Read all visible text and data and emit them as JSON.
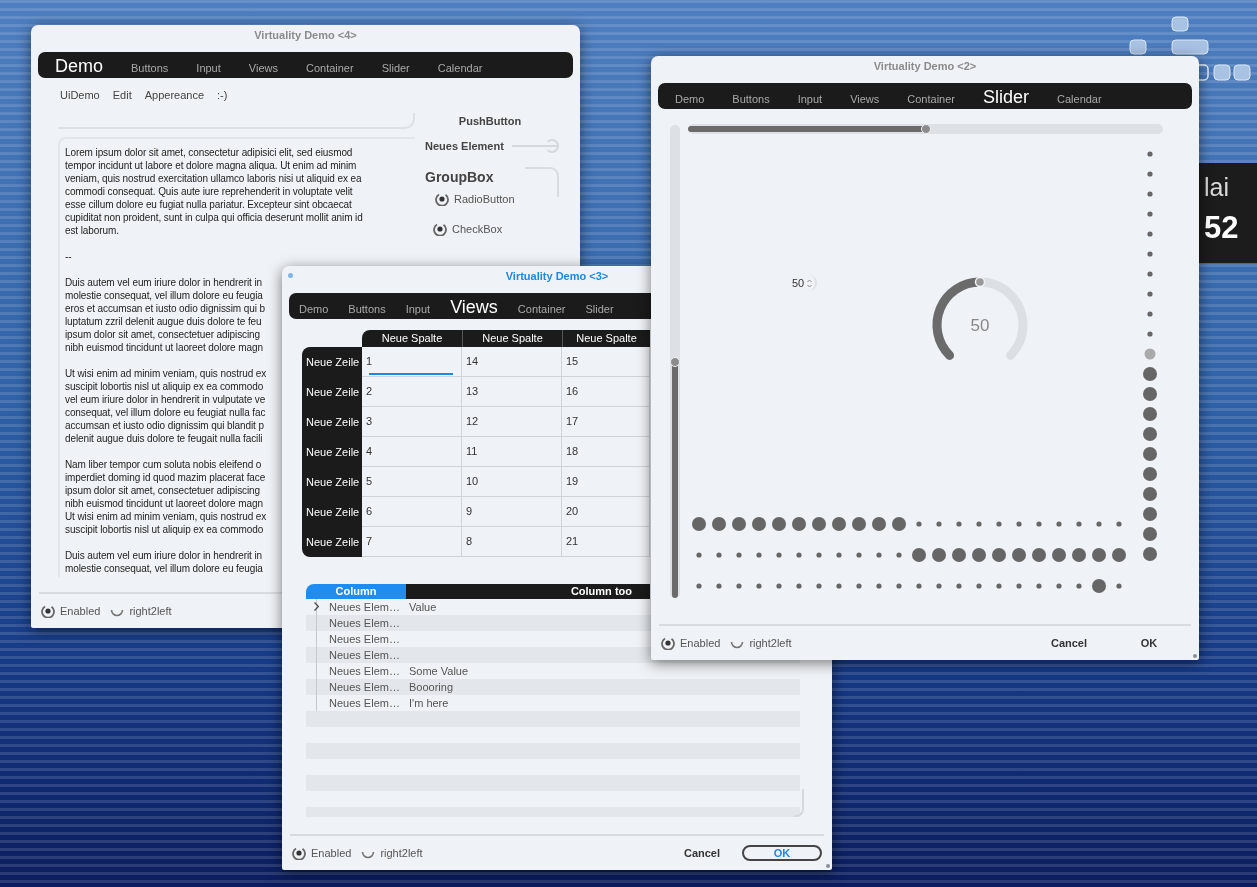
{
  "desktop": {
    "clock_lines": [
      "lai",
      "52"
    ]
  },
  "windows": [
    {
      "kind": "text_demo",
      "title": "Virtuality Demo <4>",
      "active": false,
      "tabs": [
        {
          "label": "Demo",
          "selected": true
        },
        {
          "label": "Buttons",
          "selected": false
        },
        {
          "label": "Input",
          "selected": false
        },
        {
          "label": "Views",
          "selected": false
        },
        {
          "label": "Container",
          "selected": false
        },
        {
          "label": "Slider",
          "selected": false
        },
        {
          "label": "Calendar",
          "selected": false
        }
      ],
      "menu": [
        "UiDemo",
        "Edit",
        "Appereance",
        ":-)"
      ],
      "paragraphs": [
        {
          "lines": [
            "Lorem ipsum dolor sit amet, consectetur adipisici elit, sed eiusmod",
            "tempor incidunt ut labore et dolore magna aliqua. Ut enim ad minim",
            "veniam, quis nostrud exercitation ullamco laboris nisi ut aliquid ex ea",
            "commodi consequat. Quis aute iure reprehenderit in voluptate velit",
            "esse cillum dolore eu fugiat nulla pariatur. Excepteur sint obcaecat",
            "cupiditat non proident, sunt in culpa qui officia deserunt mollit anim id",
            "est laborum."
          ]
        },
        {
          "lines": [
            "--"
          ]
        },
        {
          "lines": [
            "Duis autem vel eum iriure dolor in hendrerit in",
            "molestie consequat, vel illum dolore eu feugia",
            "eros et accumsan et iusto odio dignissim qui b",
            "luptatum zzril delenit augue duis dolore te feu",
            "ipsum dolor sit amet, consectetuer adipiscing",
            "nibh euismod tincidunt ut laoreet dolore magn"
          ]
        },
        {
          "lines": [
            "Ut wisi enim ad minim veniam, quis nostrud ex",
            "suscipit lobortis nisl ut aliquip ex ea commodo",
            "vel eum iriure dolor in hendrerit in vulputate ve",
            "consequat, vel illum dolore eu feugiat nulla fac",
            "accumsan et iusto odio dignissim qui blandit p",
            "delenit augue duis dolore te feugait nulla facili"
          ]
        },
        {
          "lines": [
            "Nam liber tempor cum soluta nobis eleifend o",
            "imperdiet doming id quod mazim placerat face",
            "ipsum dolor sit amet, consectetuer adipiscing",
            "nibh euismod tincidunt ut laoreet dolore magn",
            "Ut wisi enim ad minim veniam, quis nostrud ex",
            "suscipit lobortis nisl ut aliquip ex ea commodo"
          ]
        },
        {
          "lines": [
            "Duis autem vel eum iriure dolor in hendrerit in",
            "molestie consequat, vel illum dolore eu feugia"
          ]
        }
      ],
      "push_button": "PushButton",
      "slider": {
        "label": "Neues Element",
        "level": 1
      },
      "group_box": {
        "title": "GroupBox",
        "options": [
          {
            "kind": "radio",
            "label": "RadioButton",
            "checked": true
          },
          {
            "kind": "checkbox",
            "label": "CheckBox",
            "checked": true
          }
        ]
      },
      "footer": {
        "options": [
          {
            "label": "Enabled",
            "checked": true
          },
          {
            "label": "right2left",
            "checked": false
          }
        ]
      }
    },
    {
      "kind": "views",
      "title": "Virtuality Demo <3>",
      "active": true,
      "tabs": [
        {
          "label": "Demo",
          "selected": false
        },
        {
          "label": "Buttons",
          "selected": false
        },
        {
          "label": "Input",
          "selected": false
        },
        {
          "label": "Views",
          "selected": true
        },
        {
          "label": "Container",
          "selected": false
        },
        {
          "label": "Slider",
          "selected": false
        }
      ],
      "table": {
        "columns": [
          "Neue Spalte",
          "Neue Spalte",
          "Neue Spalte"
        ],
        "rows": [
          {
            "header": "Neue Zeile",
            "cells": [
              {
                "text": "1",
                "editing": true
              },
              {
                "text": "14",
                "editing": false
              },
              {
                "text": "15",
                "editing": false
              }
            ]
          },
          {
            "header": "Neue Zeile",
            "cells": [
              {
                "text": "2",
                "editing": false
              },
              {
                "text": "13",
                "editing": false
              },
              {
                "text": "16",
                "editing": false
              }
            ]
          },
          {
            "header": "Neue Zeile",
            "cells": [
              {
                "text": "3",
                "editing": false
              },
              {
                "text": "12",
                "editing": false
              },
              {
                "text": "17",
                "editing": false
              }
            ]
          },
          {
            "header": "Neue Zeile",
            "cells": [
              {
                "text": "4",
                "editing": false
              },
              {
                "text": "11",
                "editing": false
              },
              {
                "text": "18",
                "editing": false
              }
            ]
          },
          {
            "header": "Neue Zeile",
            "cells": [
              {
                "text": "5",
                "editing": false
              },
              {
                "text": "10",
                "editing": false
              },
              {
                "text": "19",
                "editing": false
              }
            ]
          },
          {
            "header": "Neue Zeile",
            "cells": [
              {
                "text": "6",
                "editing": false
              },
              {
                "text": "9",
                "editing": false
              },
              {
                "text": "20",
                "editing": false
              }
            ]
          },
          {
            "header": "Neue Zeile",
            "cells": [
              {
                "text": "7",
                "editing": false
              },
              {
                "text": "8",
                "editing": false
              },
              {
                "text": "21",
                "editing": false
              }
            ]
          }
        ]
      },
      "tree": {
        "columns": [
          {
            "label": "Column",
            "selected": true
          },
          {
            "label": "Column too",
            "selected": false
          }
        ],
        "rows": [
          {
            "name": "Neues Elem…",
            "value": "Value",
            "expandable": true
          },
          {
            "name": "Neues Elem…",
            "expandable": false
          },
          {
            "name": "Neues Elem…",
            "expandable": false
          },
          {
            "name": "Neues Elem…",
            "expandable": false
          },
          {
            "name": "Neues Elem…",
            "value": "Some Value",
            "expandable": false
          },
          {
            "name": "Neues Elem…",
            "value": "Boooring",
            "expandable": false
          },
          {
            "name": "Neues Elem…",
            "value": "I'm here",
            "expandable": false
          }
        ]
      },
      "footer": {
        "options": [
          {
            "label": "Enabled",
            "checked": true
          },
          {
            "label": "right2left",
            "checked": false
          }
        ],
        "buttons": [
          {
            "label": "Cancel",
            "default": false
          },
          {
            "label": "OK",
            "default": true
          }
        ]
      }
    },
    {
      "kind": "slider",
      "title": "Virtuality Demo <2>",
      "active": false,
      "tabs": [
        {
          "label": "Demo",
          "selected": false
        },
        {
          "label": "Buttons",
          "selected": false
        },
        {
          "label": "Input",
          "selected": false
        },
        {
          "label": "Views",
          "selected": false
        },
        {
          "label": "Container",
          "selected": false
        },
        {
          "label": "Slider",
          "selected": true
        },
        {
          "label": "Calendar",
          "selected": false
        }
      ],
      "h_slider": {
        "level": 0.5
      },
      "v_slider": {
        "level": 0.5
      },
      "spin": {
        "value": "50"
      },
      "dial": {
        "level": 0.5,
        "reading": "50"
      },
      "dot_column": {
        "level": 0.5
      },
      "dot_rows": [
        {
          "kind": "fill",
          "level": 0.5
        },
        {
          "kind": "fill_reverse",
          "level": 0.5
        },
        {
          "kind": "single",
          "level": 0.952
        }
      ],
      "footer": {
        "options": [
          {
            "label": "Enabled",
            "checked": true
          },
          {
            "label": "right2left",
            "checked": false
          }
        ],
        "buttons": [
          {
            "label": "Cancel",
            "default": false
          },
          {
            "label": "OK",
            "default": false
          }
        ]
      }
    }
  ]
}
